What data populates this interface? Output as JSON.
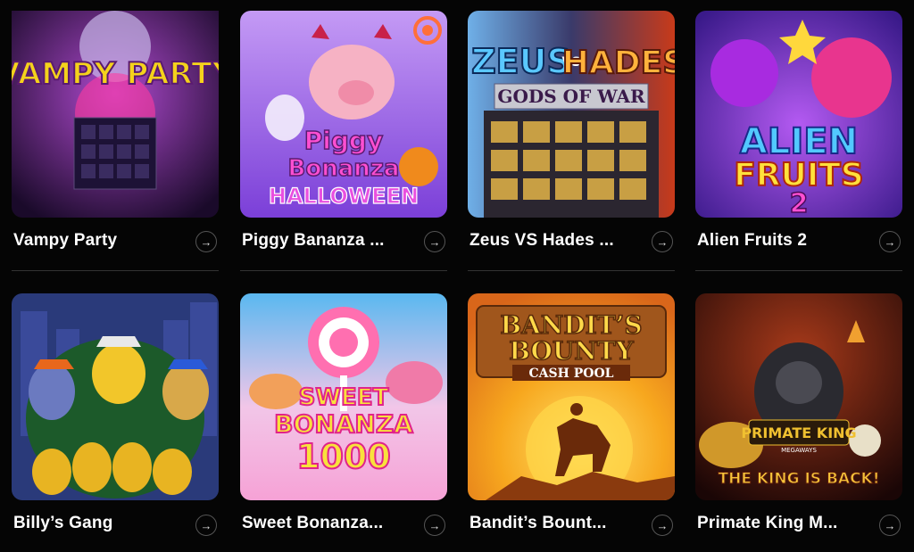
{
  "games": [
    {
      "title": "Vampy Party",
      "art_text": [
        "VAMPY PARTY"
      ],
      "icon": "vampy-party-art",
      "colors": {
        "accent": "#f4d21c",
        "bg": "#3a1a5a"
      }
    },
    {
      "title": "Piggy Bananza ...",
      "art_text": [
        "Piggy",
        "Bonanza",
        "HALLOWEEN"
      ],
      "icon": "piggy-bonanza-art",
      "colors": {
        "accent": "#e63cc7",
        "bg": "#a874ea"
      }
    },
    {
      "title": "Zeus VS Hades ...",
      "art_text": [
        "ZEUS",
        "VS",
        "HADES",
        "GODS OF WAR"
      ],
      "icon": "zeus-vs-hades-art",
      "colors": {
        "accent": "#5ac8ff",
        "bg": "#2b3f73"
      }
    },
    {
      "title": "Alien Fruits 2",
      "art_text": [
        "ALIEN",
        "FRUITS",
        "2"
      ],
      "icon": "alien-fruits-art",
      "colors": {
        "accent": "#52c9ff",
        "bg": "#7a2ce0"
      }
    },
    {
      "title": "Billy’s Gang",
      "art_text": [],
      "icon": "billys-gang-art",
      "colors": {
        "accent": "#f4c331",
        "bg": "#1f2f6a"
      }
    },
    {
      "title": "Sweet Bonanza...",
      "art_text": [
        "SWEET",
        "BONANZA",
        "1000"
      ],
      "icon": "sweet-bonanza-art",
      "colors": {
        "accent": "#f14ba6",
        "bg": "#62c8f2"
      }
    },
    {
      "title": "Bandit’s Bount...",
      "art_text": [
        "BANDIT’S",
        "BOUNTY",
        "CASH POOL"
      ],
      "icon": "bandits-bounty-art",
      "colors": {
        "accent": "#7a3a0e",
        "bg": "#f6a81e"
      }
    },
    {
      "title": "Primate King M...",
      "art_text": [
        "PRIMATE KING",
        "MEGAWAYS",
        "THE KING IS BACK!"
      ],
      "icon": "primate-king-art",
      "colors": {
        "accent": "#f0c030",
        "bg": "#3a1410"
      }
    }
  ],
  "arrow_glyph": "→"
}
